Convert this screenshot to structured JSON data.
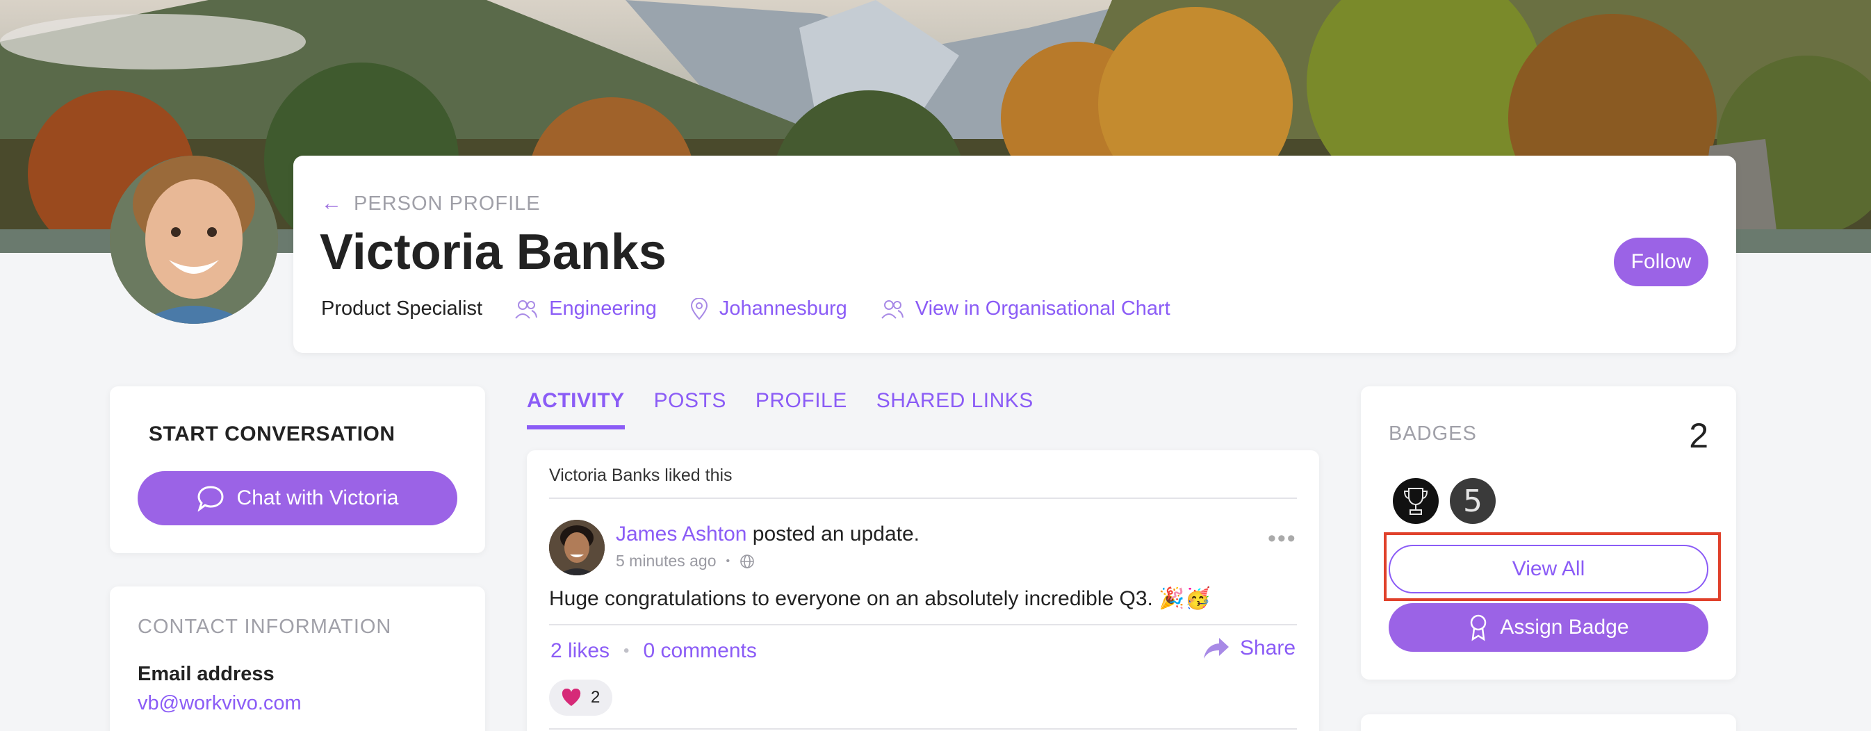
{
  "header": {
    "breadcrumb": "PERSON PROFILE",
    "name": "Victoria Banks",
    "job_title": "Product Specialist",
    "department": "Engineering",
    "location": "Johannesburg",
    "org_chart_link": "View in Organisational Chart",
    "follow_label": "Follow"
  },
  "start_conversation": {
    "title": "START CONVERSATION",
    "chat_label": "Chat with Victoria"
  },
  "contact": {
    "title": "CONTACT INFORMATION",
    "email_label": "Email address",
    "email_value": "vb@workvivo.com"
  },
  "tabs": [
    {
      "label": "ACTIVITY",
      "active": true
    },
    {
      "label": "POSTS",
      "active": false
    },
    {
      "label": "PROFILE",
      "active": false
    },
    {
      "label": "SHARED LINKS",
      "active": false
    }
  ],
  "feed": {
    "liked_line": "Victoria Banks liked this",
    "author": "James Ashton",
    "action": " posted an update.",
    "time": "5 minutes ago",
    "body": "Huge congratulations to everyone on an absolutely incredible Q3. 🎉🥳",
    "likes": "2 likes",
    "comments": "0 comments",
    "share_label": "Share",
    "reaction_count": "2"
  },
  "badges": {
    "title": "BADGES",
    "count": "2",
    "view_all_label": "View All",
    "assign_label": "Assign Badge",
    "items": [
      "trophy-badge",
      "five-badge"
    ]
  },
  "colors": {
    "accent": "#8b5cf6",
    "button": "#9b63e6",
    "highlight": "#e0412b"
  }
}
